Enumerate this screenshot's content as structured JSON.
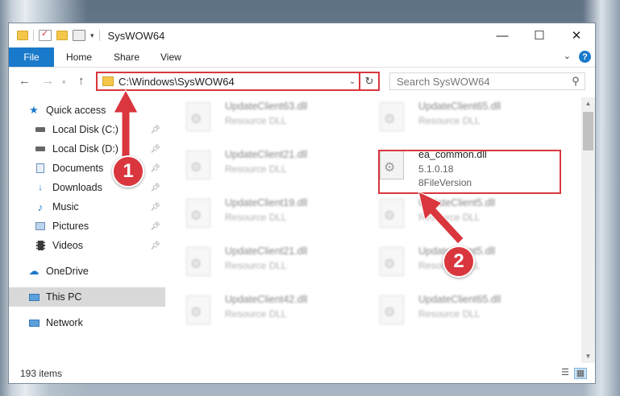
{
  "window": {
    "title": "SysWOW64",
    "minimize_glyph": "—",
    "maximize_glyph": "☐",
    "close_glyph": "✕"
  },
  "ribbon": {
    "file_label": "File",
    "tabs": [
      "Home",
      "Share",
      "View"
    ],
    "help_label": "?"
  },
  "navigation": {
    "address_path": "C:\\Windows\\SysWOW64",
    "search_placeholder": "Search SysWOW64"
  },
  "sidebar": {
    "items": [
      {
        "label": "Quick access",
        "icon": "star-icon"
      },
      {
        "label": "Local Disk (C:)",
        "icon": "drive-icon",
        "pinned": true
      },
      {
        "label": "Local Disk (D:)",
        "icon": "drive-icon",
        "pinned": true
      },
      {
        "label": "Documents",
        "icon": "documents-icon",
        "pinned": true
      },
      {
        "label": "Downloads",
        "icon": "download-icon",
        "pinned": true
      },
      {
        "label": "Music",
        "icon": "music-icon",
        "pinned": true
      },
      {
        "label": "Pictures",
        "icon": "pictures-icon",
        "pinned": true
      },
      {
        "label": "Videos",
        "icon": "videos-icon",
        "pinned": true
      },
      {
        "label": "OneDrive",
        "icon": "cloud-icon"
      },
      {
        "label": "This PC",
        "icon": "computer-icon",
        "selected": true
      },
      {
        "label": "Network",
        "icon": "network-icon"
      }
    ]
  },
  "files": [
    {
      "name": "UpdateClient63.dll",
      "description": "Resource DLL"
    },
    {
      "name": "UpdateClient65.dll",
      "description": "Resource DLL"
    },
    {
      "name": "UpdateClient21.dll",
      "description": "Resource DLL"
    },
    {
      "name": "ea_common.dll",
      "version": "5.1.0.18",
      "description": "8FileVersion",
      "highlighted": true
    },
    {
      "name": "UpdateClient19.dll",
      "description": "Resource DLL"
    },
    {
      "name": "UpdateClient5.dll",
      "description": "Resource DLL"
    },
    {
      "name": "UpdateClient21.dll",
      "description": "Resource DLL"
    },
    {
      "name": "UpdateClient5.dll",
      "description": "Resource DLL"
    },
    {
      "name": "UpdateClient42.dll",
      "description": "Resource DLL"
    },
    {
      "name": "UpdateClient65.dll",
      "description": "Resource DLL"
    }
  ],
  "status": {
    "item_count": "193 items"
  },
  "annotations": {
    "step1": "1",
    "step2": "2",
    "color": "#d9363e"
  },
  "colors": {
    "accent": "#1979ca",
    "highlight": "#d9363e",
    "folder": "#f4c64a"
  }
}
